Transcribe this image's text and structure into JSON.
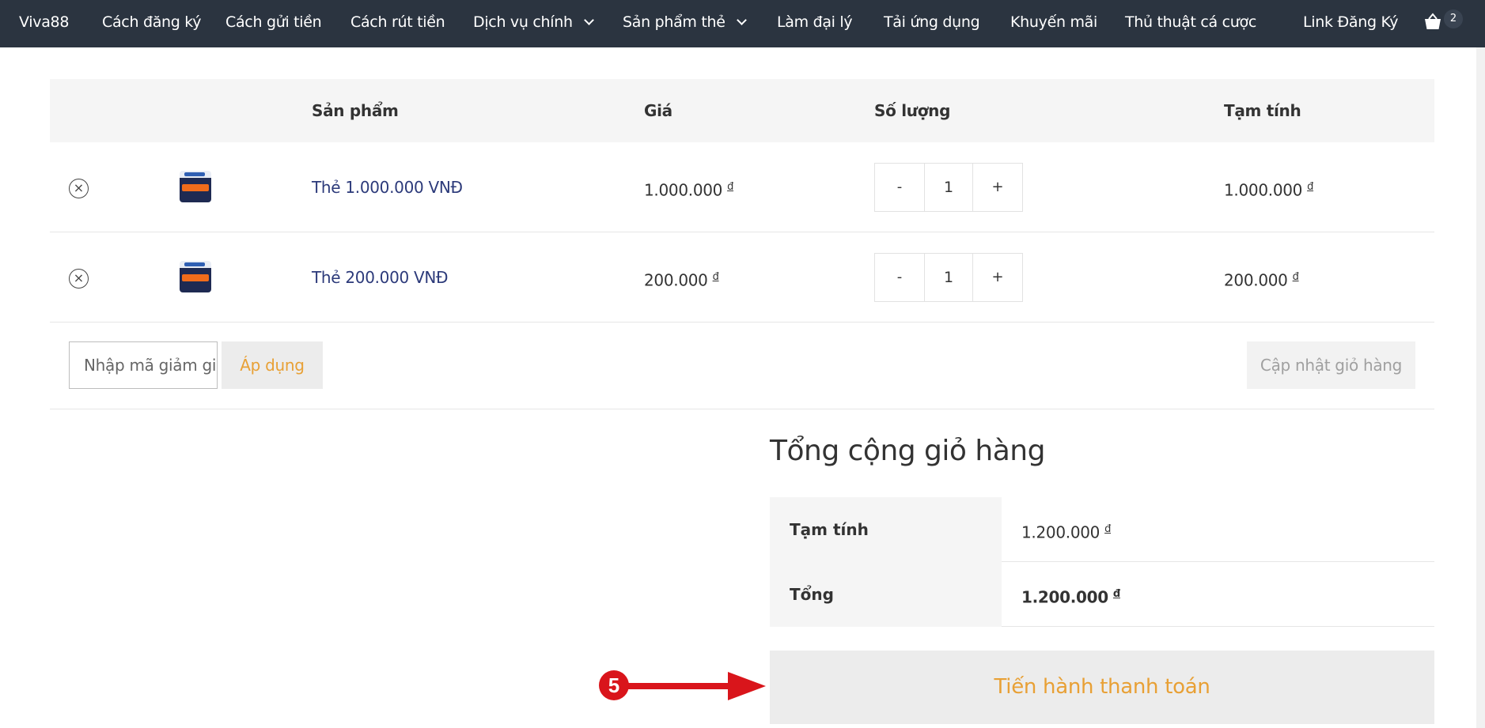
{
  "nav": {
    "brand": "Viva88",
    "items": [
      "Cách đăng ký",
      "Cách gửi tiền",
      "Cách rút tiền",
      "Dịch vụ chính",
      "Sản phẩm thẻ",
      "Làm đại lý",
      "Tải ứng dụng",
      "Khuyến mãi",
      "Thủ thuật cá cược",
      "Link Đăng Ký"
    ],
    "cart_count": "2",
    "cart_icon": "shopping-basket-icon"
  },
  "table": {
    "headers": [
      "Sản phẩm",
      "Giá",
      "Số lượng",
      "Tạm tính"
    ],
    "rows": [
      {
        "remove": "×",
        "name": "Thẻ 1.000.000 VNĐ",
        "price": "1.000.000",
        "currency": "đ",
        "qty": "1",
        "subtotal": "1.000.000"
      },
      {
        "remove": "×",
        "name": "Thẻ 200.000 VNĐ",
        "price": "200.000",
        "currency": "đ",
        "qty": "1",
        "subtotal": "200.000"
      }
    ],
    "minus": "-",
    "plus": "+"
  },
  "coupon": {
    "placeholder": "Nhập mã giảm giá",
    "apply_label": "Áp dụng",
    "update_label": "Cập nhật giỏ hàng"
  },
  "totals": {
    "title": "Tổng cộng giỏ hàng",
    "subtotal_label": "Tạm tính",
    "subtotal_value": "1.200.000",
    "total_label": "Tổng",
    "total_value": "1.200.000",
    "currency": "đ",
    "checkout_label": "Tiến hành thanh toán"
  },
  "annotation": {
    "step": "5",
    "color": "#d9151b"
  }
}
